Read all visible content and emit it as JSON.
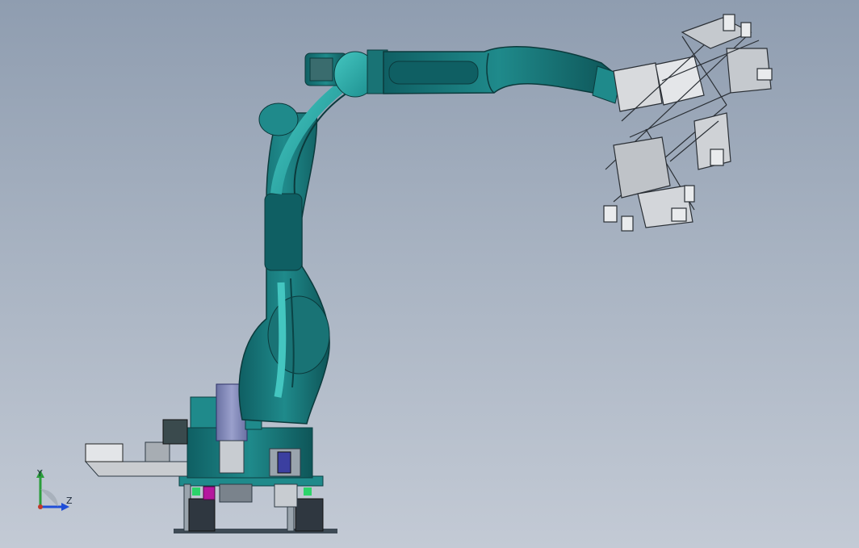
{
  "view": {
    "background_top": "#8f9db0",
    "background_bottom": "#c3cad5"
  },
  "model": {
    "robot_color": "#1f7f82",
    "robot_highlight": "#2fb8b4",
    "motor_color": "#7f86b8",
    "accent_magenta": "#b5179e",
    "gripper_color": "#d8dadd"
  },
  "triad": {
    "y_label": "Y",
    "z_label": "Z",
    "y_color": "#2a9d3a",
    "z_color": "#1f4ed8",
    "origin_color": "#c0392b"
  }
}
